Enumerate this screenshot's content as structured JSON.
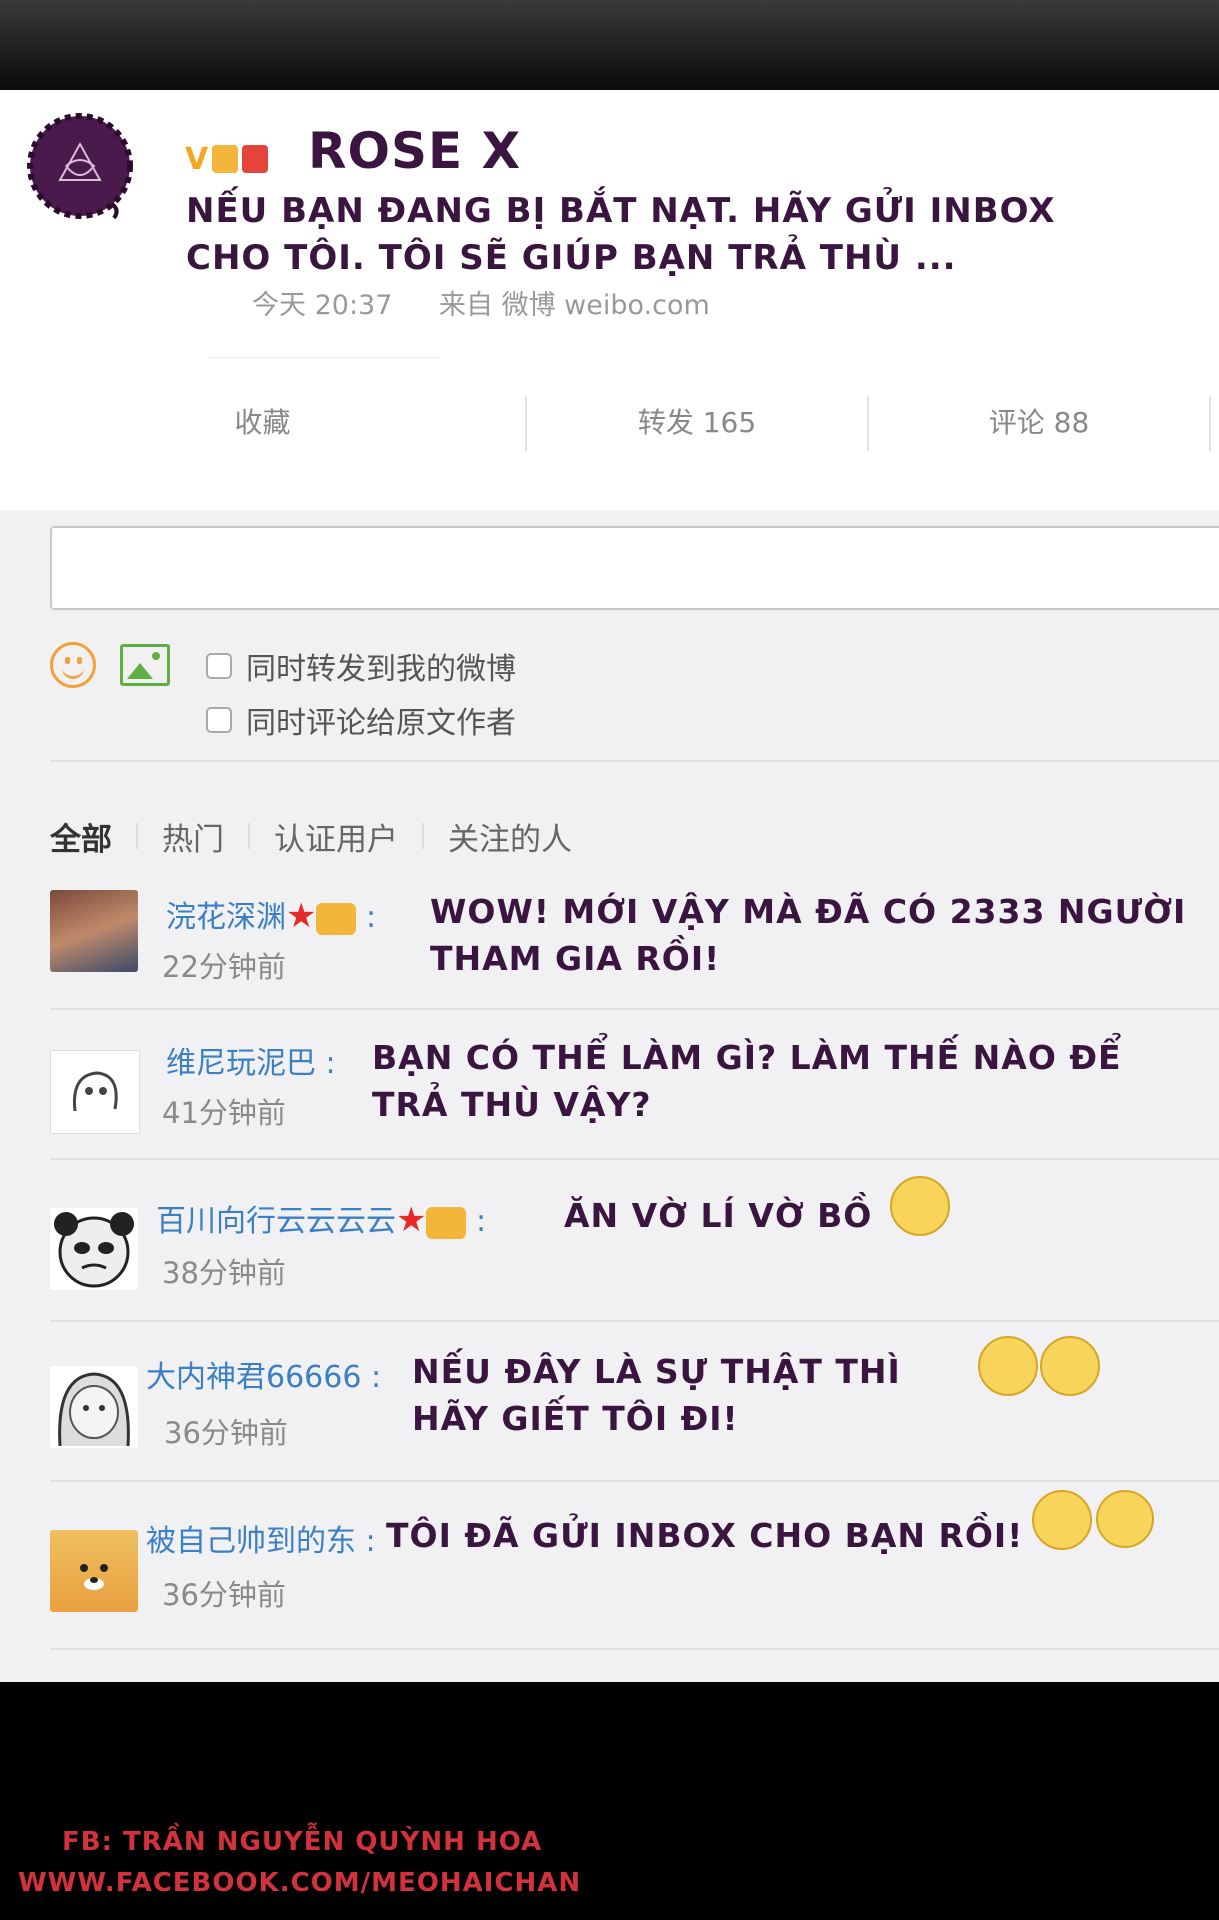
{
  "post": {
    "author": "ROSE X",
    "badge_v": "V",
    "text_line1": "NẾU BẠN ĐANG BỊ BẮT NẠT. HÃY GỬI INBOX",
    "text_line2": "CHO TÔI. TÔI SẼ GIÚP BẠN TRẢ THÙ ...",
    "time": "今天 20:37",
    "source": "来自 微博 weibo.com"
  },
  "actions": {
    "favorite": "收藏",
    "repost": "转发 165",
    "comment": "评论 88"
  },
  "composer": {
    "checkbox_repost": "同时转发到我的微博",
    "checkbox_comment": "同时评论给原文作者"
  },
  "tabs": [
    "全部",
    "热门",
    "认证用户",
    "关注的人"
  ],
  "comments": [
    {
      "user": "浣花深渊",
      "time": "22分钟前",
      "line1": "WOW! MỚI VẬY MÀ ĐÃ CÓ 2333 NGƯỜI",
      "line2": "THAM GIA RỒI!"
    },
    {
      "user": "维尼玩泥巴",
      "time": "41分钟前",
      "line1": "BẠN CÓ THỂ LÀM GÌ? LÀM THẾ NÀO ĐỂ",
      "line2": "TRẢ THÙ VẬY?"
    },
    {
      "user": "百川向行云云云云",
      "time": "38分钟前",
      "line1": "ĂN VỜ LÍ VỜ BỒ",
      "line2": ""
    },
    {
      "user": "大内神君66666",
      "time": "36分钟前",
      "line1": "NẾU ĐÂY LÀ SỰ THẬT THÌ",
      "line2": "HÃY GIẾT TÔI ĐI!"
    },
    {
      "user": "被自己帅到的东",
      "time": "36分钟前",
      "line1": "TÔI ĐÃ GỬI INBOX CHO BẠN RỒI!",
      "line2": ""
    }
  ],
  "footer": {
    "fb": "FB: TRẦN NGUYỄN QUỲNH HOA",
    "url": "WWW.FACEBOOK.COM/MEOHAICHAN"
  },
  "colors": {
    "accent_text": "#3a1540",
    "username": "#3b7fc4",
    "watermark": "#d2323c"
  }
}
